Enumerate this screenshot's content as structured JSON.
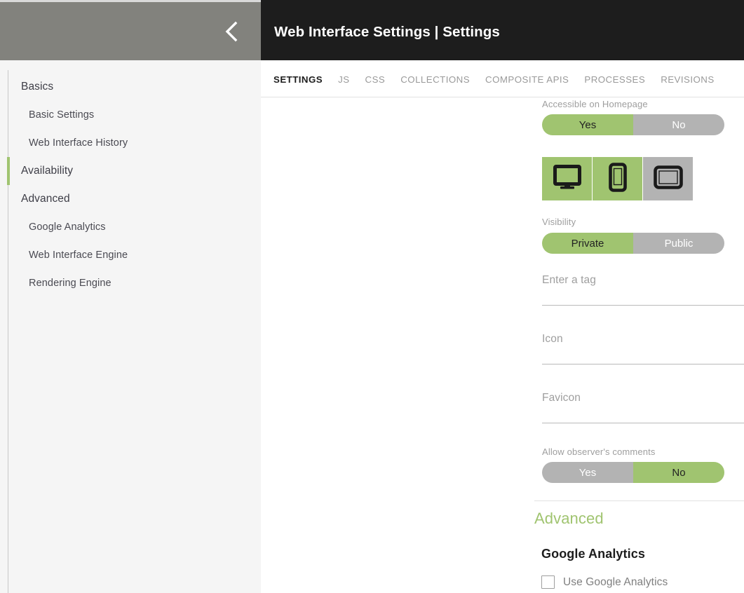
{
  "window": {
    "back_button_icon": "chevron-left-icon"
  },
  "header": {
    "title": "Web Interface Settings | Settings"
  },
  "sidebar": {
    "items": [
      {
        "label": "Basics",
        "level": 0,
        "active": false
      },
      {
        "label": "Basic Settings",
        "level": 1,
        "active": false
      },
      {
        "label": "Web Interface History",
        "level": 1,
        "active": false
      },
      {
        "label": "Availability",
        "level": 0,
        "active": true
      },
      {
        "label": "Advanced",
        "level": 0,
        "active": false
      },
      {
        "label": "Google Analytics",
        "level": 1,
        "active": false
      },
      {
        "label": "Web Interface Engine",
        "level": 1,
        "active": false
      },
      {
        "label": "Rendering Engine",
        "level": 1,
        "active": false
      }
    ]
  },
  "tabs": [
    {
      "label": "SETTINGS",
      "active": true
    },
    {
      "label": "JS",
      "active": false
    },
    {
      "label": "CSS",
      "active": false
    },
    {
      "label": "COLLECTIONS",
      "active": false
    },
    {
      "label": "COMPOSITE APIS",
      "active": false
    },
    {
      "label": "PROCESSES",
      "active": false
    },
    {
      "label": "REVISIONS",
      "active": false
    }
  ],
  "form": {
    "accessible_on_homepage": {
      "label": "Accessible on Homepage",
      "yes_label": "Yes",
      "no_label": "No",
      "selected": "Yes"
    },
    "devices": [
      {
        "name": "desktop",
        "icon": "desktop-monitor-icon",
        "selected": true
      },
      {
        "name": "mobile",
        "icon": "mobile-phone-icon",
        "selected": true
      },
      {
        "name": "tablet",
        "icon": "tablet-icon",
        "selected": false
      }
    ],
    "visibility": {
      "label": "Visibility",
      "private_label": "Private",
      "public_label": "Public",
      "selected": "Private"
    },
    "tag": {
      "placeholder": "Enter a tag",
      "value": ""
    },
    "icon": {
      "placeholder": "Icon",
      "value": "",
      "action_icon": "link-icon"
    },
    "favicon": {
      "placeholder": "Favicon",
      "value": "",
      "action_icon": "link-icon"
    },
    "observer_comments": {
      "label": "Allow observer's comments",
      "yes_label": "Yes",
      "no_label": "No",
      "selected": "No"
    }
  },
  "advanced": {
    "section_title": "Advanced",
    "google_analytics_title": "Google Analytics",
    "use_google_analytics_label": "Use Google Analytics",
    "use_google_analytics_checked": false
  },
  "colors": {
    "accent_green": "#a0c470",
    "toggle_gray": "#b3b3b3",
    "header_dark": "#1d1d1d",
    "header_gray": "#82827d",
    "sidebar_bg": "#f5f5f5"
  }
}
